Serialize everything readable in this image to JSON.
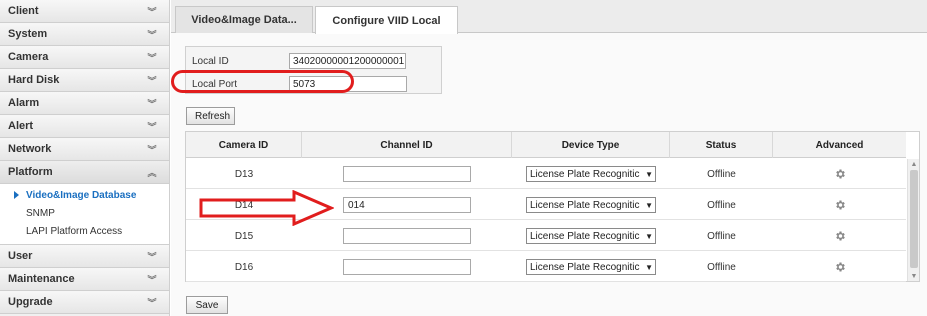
{
  "sidebar": {
    "items": [
      {
        "label": "Client",
        "chevron": "double-chevron-down"
      },
      {
        "label": "System",
        "chevron": "double-chevron-down"
      },
      {
        "label": "Camera",
        "chevron": "double-chevron-down"
      },
      {
        "label": "Hard Disk",
        "chevron": "double-chevron-down"
      },
      {
        "label": "Alarm",
        "chevron": "double-chevron-down"
      },
      {
        "label": "Alert",
        "chevron": "double-chevron-down"
      },
      {
        "label": "Network",
        "chevron": "double-chevron-down"
      },
      {
        "label": "Platform",
        "chevron": "double-chevron-up"
      },
      {
        "label": "User",
        "chevron": "double-chevron-down"
      },
      {
        "label": "Maintenance",
        "chevron": "double-chevron-down"
      },
      {
        "label": "Upgrade",
        "chevron": "double-chevron-down"
      }
    ],
    "platform_sub": [
      {
        "label": "Video&Image Database",
        "active": true
      },
      {
        "label": "SNMP",
        "active": false
      },
      {
        "label": "LAPI Platform Access",
        "active": false
      }
    ]
  },
  "tabs": [
    {
      "label": "Video&Image Data..."
    },
    {
      "label": "Configure VIID Local"
    }
  ],
  "form": {
    "local_id_label": "Local ID",
    "local_id_value": "34020000001200000001",
    "local_port_label": "Local Port",
    "local_port_value": "5073"
  },
  "buttons": {
    "refresh": "Refresh",
    "save": "Save"
  },
  "table": {
    "headers": [
      "Camera ID",
      "Channel ID",
      "Device Type",
      "Status",
      "Advanced"
    ],
    "rows": [
      {
        "camera_id": "D13",
        "channel_id": "",
        "device_type": "License Plate Recognitic",
        "status": "Offline"
      },
      {
        "camera_id": "D14",
        "channel_id": "014",
        "device_type": "License Plate Recognitic",
        "status": "Offline"
      },
      {
        "camera_id": "D15",
        "channel_id": "",
        "device_type": "License Plate Recognitic",
        "status": "Offline"
      },
      {
        "camera_id": "D16",
        "channel_id": "",
        "device_type": "License Plate Recognitic",
        "status": "Offline"
      }
    ]
  },
  "annotations": {
    "highlight_color": "#e11d1d"
  },
  "colors": {
    "active_link": "#1a6fc0",
    "gear": "#888888"
  }
}
